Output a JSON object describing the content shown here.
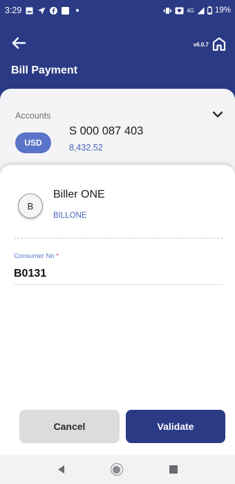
{
  "status_bar": {
    "time": "3:29",
    "network": "4G",
    "battery": "19%",
    "icons": [
      "gallery-icon",
      "send-icon",
      "facebook-icon",
      "square-icon",
      "vibrate-icon",
      "wifi-icon",
      "signal-icon",
      "battery-icon"
    ]
  },
  "header": {
    "version": "v6.0.7",
    "title": "Bill Payment",
    "icons": [
      "back-arrow-icon",
      "home-icon"
    ]
  },
  "account": {
    "label": "Accounts",
    "currency": "USD",
    "number": "S 000 087 403",
    "balance": "8,432.52"
  },
  "biller": {
    "initial": "B",
    "name": "Biller ONE",
    "code": "BILLONE"
  },
  "consumer_field": {
    "label": "Consumer No",
    "required_mark": "*",
    "value": "B0131"
  },
  "actions": {
    "cancel": "Cancel",
    "validate": "Validate"
  },
  "colors": {
    "primary": "#2a3a84",
    "accent": "#5a74c9",
    "link": "#4a63b8",
    "required": "#d63232"
  }
}
